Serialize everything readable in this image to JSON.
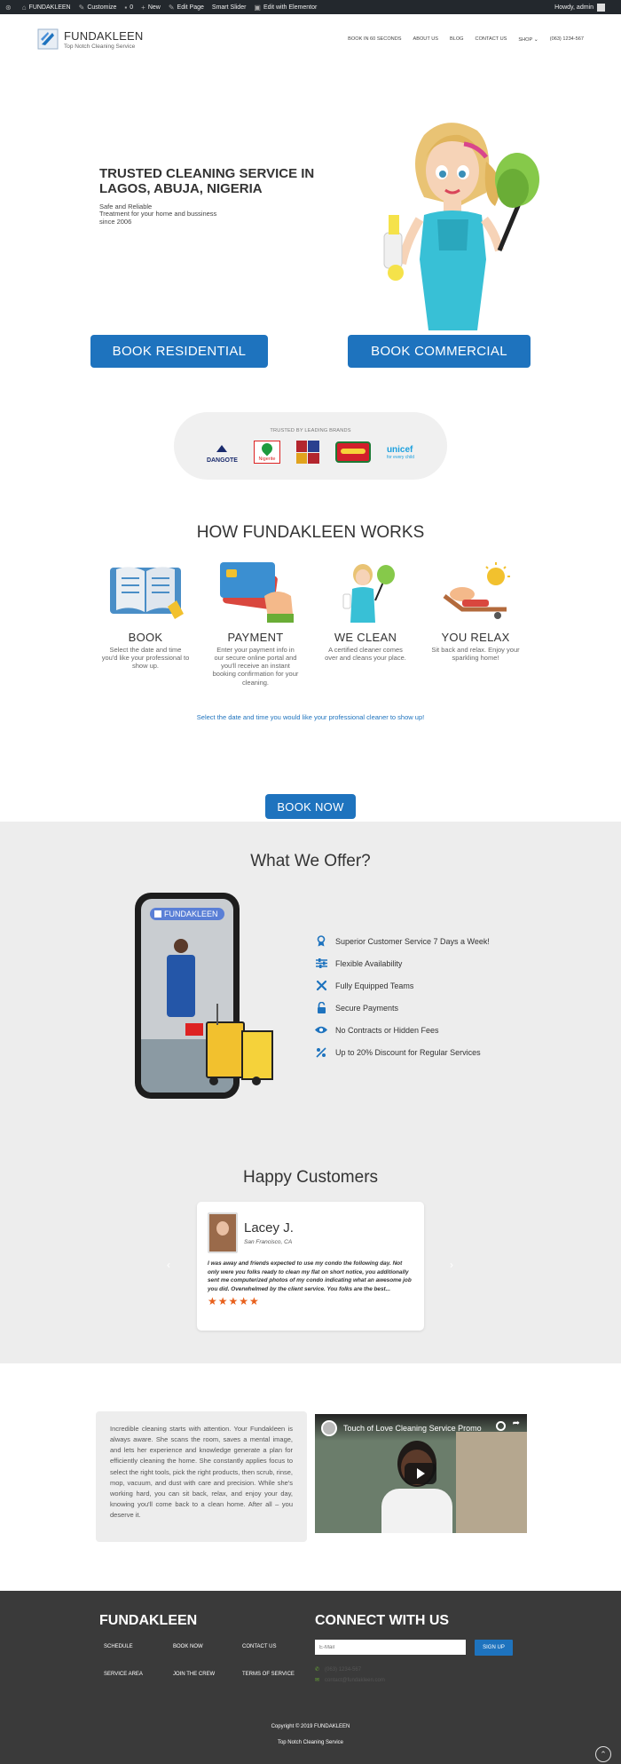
{
  "admin_bar": {
    "site": "FUNDAKLEEN",
    "customize": "Customize",
    "comments": "0",
    "new": "New",
    "edit_page": "Edit Page",
    "smart_slider": "Smart Slider",
    "elementor": "Edit with Elementor",
    "howdy": "Howdy, admin"
  },
  "header": {
    "logo_title": "FUNDAKLEEN",
    "logo_sub": "Top Notch Cleaning Service",
    "nav": [
      "BOOK IN 60 SECONDS",
      "ABOUT US",
      "BLOG",
      "CONTACT US",
      "SHOP",
      "(063) 1234-567"
    ]
  },
  "hero": {
    "title": "TRUSTED CLEANING SERVICE IN LAGOS, ABUJA, NIGERIA",
    "sub1": "Safe and Reliable",
    "sub2": "Treatment for your home and bussiness",
    "sub3": "since 2006",
    "btn_residential": "BOOK RESIDENTIAL",
    "btn_commercial": "BOOK COMMERCIAL"
  },
  "brands": {
    "title": "TRUSTED BY LEADING BRANDS",
    "dangote": "DANGOTE",
    "nigerite": "Nigerite",
    "unicef": "unicef",
    "unicef_tag": "for every child"
  },
  "how": {
    "title": "HOW FUNDAKLEEN WORKS",
    "steps": [
      {
        "title": "BOOK",
        "text": "Select the date and time you'd like your professional to show up."
      },
      {
        "title": "PAYMENT",
        "text": "Enter your payment info in our secure online portal and you'll receive an instant booking confirmation for your cleaning."
      },
      {
        "title": "WE CLEAN",
        "text": "A certified cleaner comes over and cleans your place."
      },
      {
        "title": "YOU RELAX",
        "text": "Sit back and relax. Enjoy your sparkling home!"
      }
    ],
    "cta_text": "Select the date and time you would like your professional cleaner to show up!",
    "cta_btn": "BOOK NOW"
  },
  "offer": {
    "title": "What We Offer?",
    "phone_brand": "FUNDAKLEEN",
    "items": [
      {
        "icon": "award-icon",
        "label": "Superior Customer Service 7 Days a Week!"
      },
      {
        "icon": "sliders-icon",
        "label": "Flexible Availability"
      },
      {
        "icon": "tools-icon",
        "label": "Fully Equipped Teams"
      },
      {
        "icon": "unlock-icon",
        "label": "Secure Payments"
      },
      {
        "icon": "eye-icon",
        "label": "No Contracts or Hidden Fees"
      },
      {
        "icon": "percent-icon",
        "label": "Up to 20% Discount for Regular Services"
      }
    ]
  },
  "testimonials": {
    "title": "Happy Customers",
    "name": "Lacey J.",
    "location": "San Francisco, CA",
    "quote": "I was away and friends expected to use my condo the following day. Not only were you folks ready to clean my flat on short notice, you additionally sent me computerized photos of my condo indicating what an awesome job you did. Overwhelmed by the client service. You folks are the best...",
    "rating": 5,
    "stars": "★★★★★"
  },
  "about": {
    "text": "Incredible cleaning starts with attention. Your Fundakleen is always aware. She scans the room, saves a mental image, and lets her experience and knowledge generate a plan for efficiently cleaning the home. She constantly applies focus to select the right tools, pick the right products, then scrub, rinse, mop, vacuum, and dust with care and precision. While she's working hard, you can sit back, relax, and enjoy your day, knowing you'll come back to a clean home. After all – you deserve it.",
    "video_title": "Touch of Love Cleaning Service Promo"
  },
  "footer": {
    "brand": "FUNDAKLEEN",
    "links": [
      "SCHEDULE",
      "BOOK NOW",
      "CONTACT US",
      "SERVICE AREA",
      "JOIN THE CREW",
      "TERMS OF SERVICE"
    ],
    "connect_title": "CONNECT WITH US",
    "email_placeholder": "E-Mail",
    "signup": "SIGN UP",
    "phone": "(063) 1234-567",
    "email": "contact@fundakleen.com",
    "copyright": "Copyright © 2019 FUNDAKLEEN",
    "tagline": "Top Notch Cleaning Service"
  },
  "colors": {
    "accent": "#1e73be",
    "footer_bg": "#3a3a3a",
    "grey_bg": "#ededed",
    "star": "#e8601c"
  }
}
